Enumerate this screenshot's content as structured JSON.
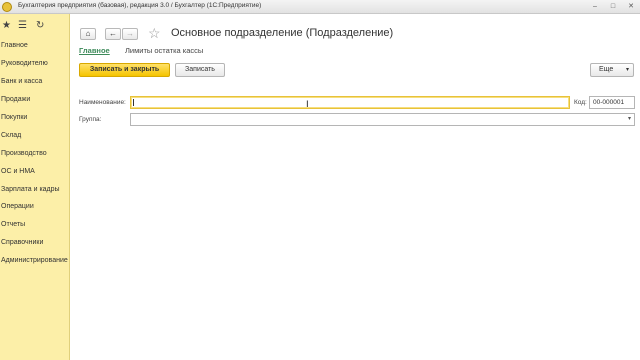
{
  "window": {
    "title": "Бухгалтерия предприятия (базовая), редакция 3.0 / Бухгалтер  (1С:Предприятие)",
    "minimize": "–",
    "maximize": "□",
    "close": "✕"
  },
  "sidebar": {
    "top_icons": {
      "favorites": "★",
      "history": "☰",
      "refresh": "↻"
    },
    "items": [
      {
        "label": "Главное"
      },
      {
        "label": "Руководителю"
      },
      {
        "label": "Банк и касса"
      },
      {
        "label": "Продажи"
      },
      {
        "label": "Покупки"
      },
      {
        "label": "Склад"
      },
      {
        "label": "Производство"
      },
      {
        "label": "ОС и НМА"
      },
      {
        "label": "Зарплата и кадры"
      },
      {
        "label": "Операции"
      },
      {
        "label": "Отчеты"
      },
      {
        "label": "Справочники"
      },
      {
        "label": "Администрирование"
      }
    ]
  },
  "nav": {
    "home": "⌂",
    "back": "←",
    "forward": "→",
    "favorite": "☆"
  },
  "form": {
    "title": "Основное подразделение (Подразделение)",
    "tabs": [
      {
        "label": "Главное"
      },
      {
        "label": "Лимиты остатка кассы"
      }
    ],
    "toolbar": {
      "save_close": "Записать и закрыть",
      "save": "Записать",
      "more": "Еще",
      "more_caret": "▾"
    },
    "fields": {
      "name_label": "Наименование:",
      "name_value": "",
      "code_label": "Код:",
      "code_value": "00-000001",
      "group_label": "Группа:",
      "group_value": "",
      "group_arrow": "▾"
    }
  }
}
